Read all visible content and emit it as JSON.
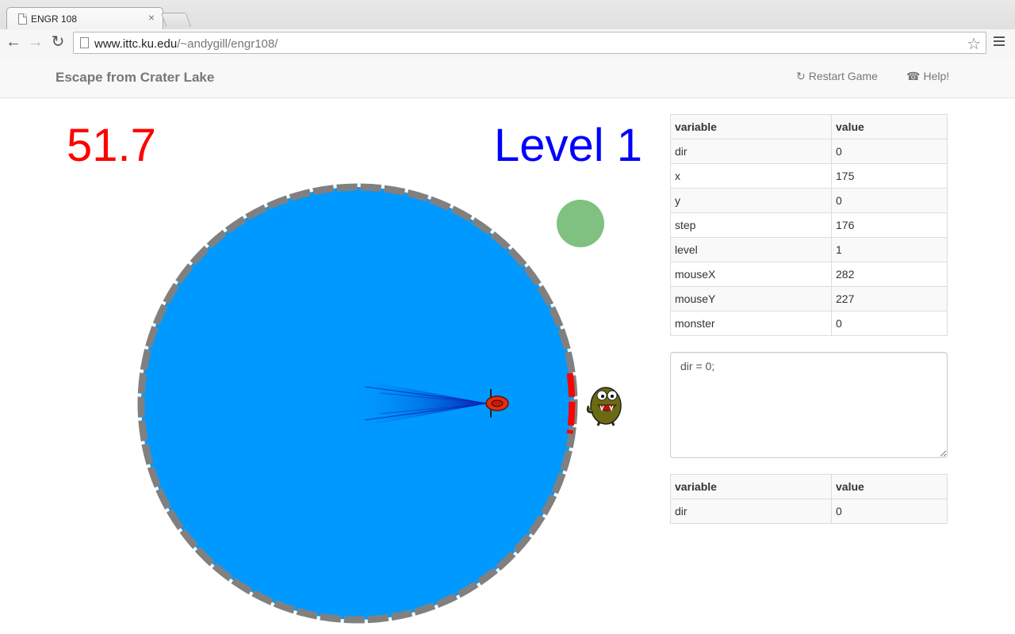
{
  "browser": {
    "tab_title": "ENGR 108",
    "tab_close": "×",
    "url_host": "www.ittc.ku.edu",
    "url_path": "/~andygill/engr108/",
    "icons": [
      "page-icon",
      "back-icon",
      "forward-icon",
      "reload-icon",
      "star-icon",
      "menu-icon"
    ]
  },
  "navbar": {
    "brand": "Escape from Crater Lake",
    "restart_label": "Restart Game",
    "help_label": "Help!",
    "restart_icon": "refresh-icon",
    "help_icon": "phone-icon"
  },
  "game": {
    "score": "51.7",
    "level": "Level 1",
    "colors": {
      "score": "#ff0000",
      "level": "#0000ff",
      "lake": "#0099ff",
      "shore": "#808080",
      "danger_arc": "#ff0000",
      "target_dot": "#80c080"
    }
  },
  "variables_table": {
    "headers": [
      "variable",
      "value"
    ],
    "rows": [
      {
        "name": "dir",
        "value": "0"
      },
      {
        "name": "x",
        "value": "175"
      },
      {
        "name": "y",
        "value": "0"
      },
      {
        "name": "step",
        "value": "176"
      },
      {
        "name": "level",
        "value": "1"
      },
      {
        "name": "mouseX",
        "value": "282"
      },
      {
        "name": "mouseY",
        "value": "227"
      },
      {
        "name": "monster",
        "value": "0"
      }
    ]
  },
  "code_editor": {
    "value": "dir = 0;"
  },
  "watch_table": {
    "headers": [
      "variable",
      "value"
    ],
    "rows": [
      {
        "name": "dir",
        "value": "0"
      }
    ]
  }
}
